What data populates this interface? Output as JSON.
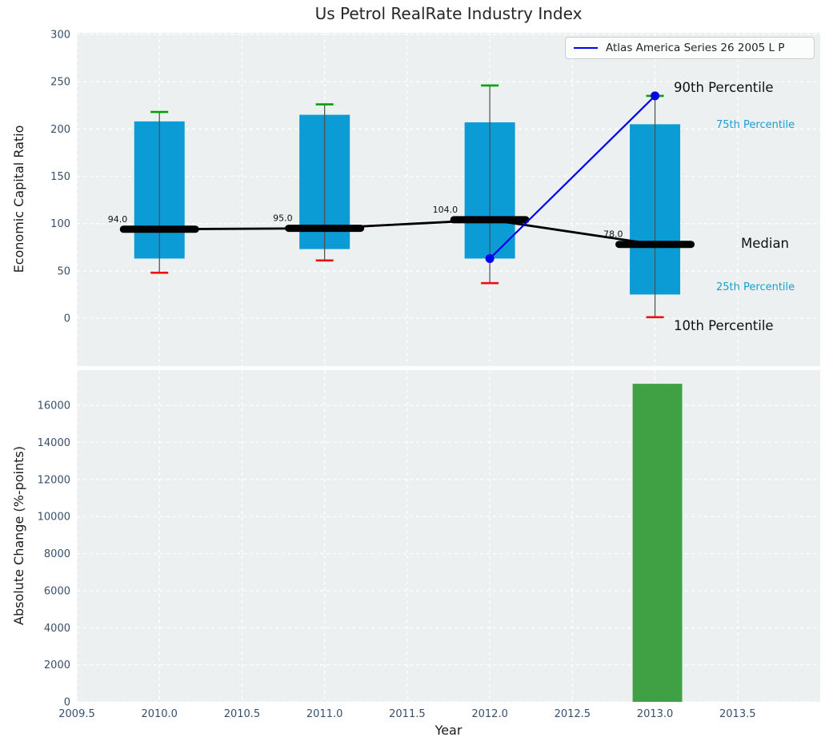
{
  "title": "Us Petrol RealRate Industry Index",
  "legend": {
    "label": "Atlas America Series 26 2005 L P"
  },
  "annotations": {
    "p90": "90th Percentile",
    "p75": "75th Percentile",
    "median": "Median",
    "p25": "25th Percentile",
    "p10": "10th Percentile"
  },
  "colors": {
    "plot_bg": "#ecf0f1",
    "grid": "#ffffff",
    "box_fill": "#0c9cd5",
    "whisker_line": "#4d4d4d",
    "cap_high": "#00a000",
    "cap_low": "#e81111",
    "median_black": "#000000",
    "series_blue": "#0000ee",
    "bar_green": "#3fa143",
    "tick_text": "#36506c",
    "annotation_cyan": "#1a9fd0",
    "value_label": "#111111"
  },
  "chart_data": [
    {
      "type": "boxplot+line",
      "title": "Us Petrol RealRate Industry Index",
      "ylabel": "Economic Capital Ratio",
      "ylim": [
        -51,
        302
      ],
      "yticks": [
        0,
        50,
        100,
        150,
        200,
        250,
        300
      ],
      "ytick_labels": [
        "0",
        "50",
        "100",
        "150",
        "200",
        "250",
        "300"
      ],
      "xlim": [
        2009.5,
        2014.0
      ],
      "xgrid": [
        2009.5,
        2010.0,
        2010.5,
        2011.0,
        2011.5,
        2012.0,
        2012.5,
        2013.0,
        2013.5
      ],
      "grid": "white dashed",
      "legend_position": "upper right",
      "boxes": [
        {
          "year": 2010,
          "p10": 48,
          "p25": 63,
          "median": 94,
          "p75": 208,
          "p90": 218,
          "median_label": "94.0"
        },
        {
          "year": 2011,
          "p10": 61,
          "p25": 73,
          "median": 95,
          "p75": 215,
          "p90": 226,
          "median_label": "95.0"
        },
        {
          "year": 2012,
          "p10": 37,
          "p25": 63,
          "median": 104,
          "p75": 207,
          "p90": 246,
          "median_label": "104.0"
        },
        {
          "year": 2013,
          "p10": 1,
          "p25": 25,
          "median": 78,
          "p75": 205,
          "p90": 235,
          "median_label": "78.0"
        }
      ],
      "series": [
        {
          "name": "Atlas America Series 26 2005 L P",
          "x": [
            2012,
            2013
          ],
          "y": [
            63,
            235
          ],
          "marker": "circle"
        }
      ]
    },
    {
      "type": "bar",
      "ylabel": "Absolute Change (%-points)",
      "xlabel": "Year",
      "ylim": [
        0,
        17980
      ],
      "yticks": [
        0,
        2000,
        4000,
        6000,
        8000,
        10000,
        12000,
        14000,
        16000
      ],
      "ytick_labels": [
        "0",
        "2000",
        "4000",
        "6000",
        "8000",
        "10000",
        "12000",
        "14000",
        "16000"
      ],
      "xlim": [
        2009.5,
        2014.0
      ],
      "xticks": [
        2009.5,
        2010.0,
        2010.5,
        2011.0,
        2011.5,
        2012.0,
        2012.5,
        2013.0,
        2013.5
      ],
      "xtick_labels": [
        "2009.5",
        "2010.0",
        "2010.5",
        "2011.0",
        "2011.5",
        "2012.0",
        "2012.5",
        "2013.0",
        "2013.5"
      ],
      "bars": [
        {
          "x": 2013,
          "value": 17160
        }
      ],
      "bar_width": 0.3
    }
  ]
}
